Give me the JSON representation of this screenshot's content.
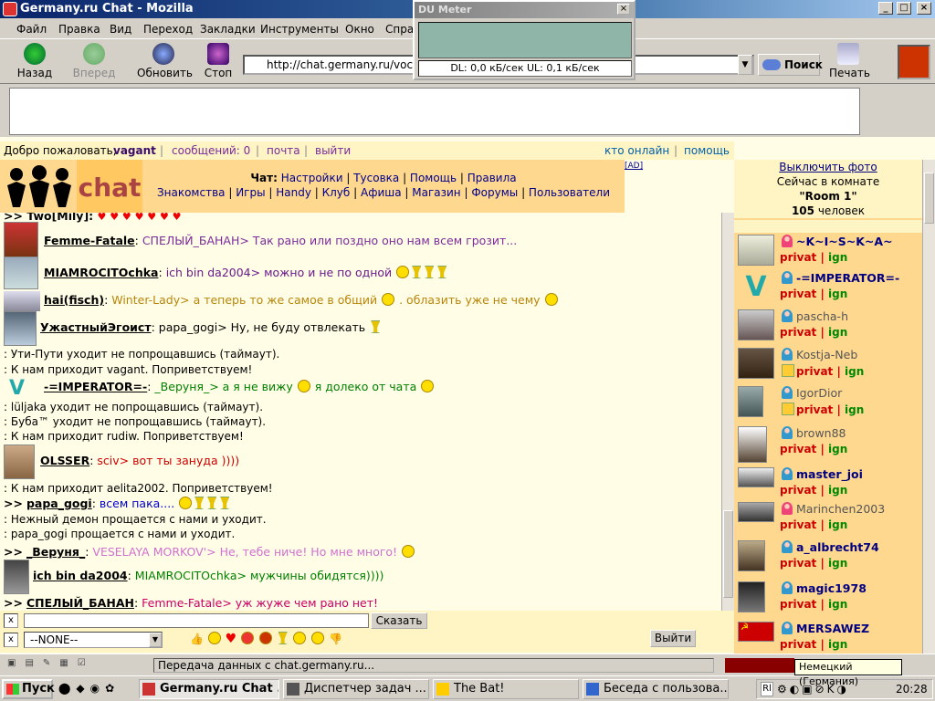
{
  "window": {
    "title": "Germany.ru Chat - Mozilla"
  },
  "menu": [
    "Файл",
    "Правка",
    "Вид",
    "Переход",
    "Закладки",
    "Инструменты",
    "Окно",
    "Справка"
  ],
  "nav": {
    "back": "Назад",
    "forward": "Вперед",
    "reload": "Обновить",
    "stop": "Стоп",
    "search": "Поиск",
    "print": "Печать",
    "url": "http://chat.germany.ru/voc/voc.php"
  },
  "dumeter": {
    "title": "DU Meter",
    "readout": "DL: 0,0 кБ/сек  UL: 0,1 кБ/сек"
  },
  "welcome": {
    "greeting": "Добро пожаловать,",
    "user": "vagant",
    "messages": "сообщений: 0",
    "mail": "почта",
    "logout": "выйти",
    "online": "кто онлайн",
    "help": "помощь",
    "ad": "[AD]"
  },
  "brand": {
    "logo": "chat"
  },
  "chatnav": {
    "lead": "Чат:",
    "row1": [
      "Настройки",
      "Тусовка",
      "Помощь",
      "Правила"
    ],
    "row2": [
      "Знакомства",
      "Игры",
      "Handy",
      "Клуб",
      "Афиша",
      "Магазин",
      "Форумы",
      "Пользователи"
    ]
  },
  "messages": [
    {
      "kind": "partial",
      "text": ">> Two[Mily]:"
    },
    {
      "kind": "msg",
      "nick": "Femme-Fatale",
      "text": "СПЕЛЫЙ_БАНАН> Так рано или поздно оно нам всем грозит...",
      "color": "#7b2c9a"
    },
    {
      "kind": "msg",
      "nick": "MIAMROCITOchka",
      "text": "ich bin da2004> можно и не по одной",
      "color": "#6a1b8a"
    },
    {
      "kind": "msg",
      "nick": "hai(fisch)",
      "text": "Winter-Lady> а теперь то же самое в общий",
      "text2": ". облазить уже не чему",
      "color": "#b8860b"
    },
    {
      "kind": "msg",
      "nick": "УжастныйЭгоист",
      "text": "papa_gogi> Ну, не буду отвлекать",
      "color": "#222222"
    },
    {
      "kind": "sys",
      "text": ": Ути-Пути уходит не попрощавшись (таймаут)."
    },
    {
      "kind": "sys",
      "text": ": К нам приходит vagant. Поприветствуем!"
    },
    {
      "kind": "msg",
      "nick": "-=IMPERATOR=-",
      "text": "_Веруня_> а я не вижу",
      "text2": "я долеко от чата",
      "color": "#008000"
    },
    {
      "kind": "sys",
      "text": ": lüljaka уходит не попрощавшись (таймаут)."
    },
    {
      "kind": "sys",
      "text": ": Буба™ уходит не попрощавшись (таймаут)."
    },
    {
      "kind": "sys",
      "text": ": К нам приходит rudiw. Поприветствуем!"
    },
    {
      "kind": "msg",
      "nick": "OLSSER",
      "text": "sciv> вот ты зануда ))))",
      "color": "#cc0000"
    },
    {
      "kind": "sys",
      "text": ": К нам приходит aelita2002. Поприветствуем!"
    },
    {
      "kind": "msg",
      "nick": "papa_gogi",
      "prefix": ">>",
      "text": "всем пака....",
      "color": "#0000cc"
    },
    {
      "kind": "sys",
      "text": ": Нежный демон прощается с нами и уходит."
    },
    {
      "kind": "sys",
      "text": ": papa_gogi прощается с нами и уходит."
    },
    {
      "kind": "msg",
      "nick": "_Веруня_",
      "prefix": ">>",
      "text": "VESELAYA MORKOV'> Не, тебе ниче! Но мне много!",
      "color": "#d070d0"
    },
    {
      "kind": "msg",
      "nick": "ich bin da2004",
      "text": "MIAMROCITOchka> мужчины обидятся))))",
      "color": "#008000"
    },
    {
      "kind": "msg",
      "nick": "СПЕЛЫЙ_БАНАН",
      "prefix": ">>",
      "text": "Femme-Fatale> уж жуже чем рано нет!",
      "color": "#cc0066"
    }
  ],
  "input": {
    "send": "Сказать",
    "recipient": "--NONE--",
    "exit": "Выйти",
    "clear": "x"
  },
  "sidebar": {
    "photos_off": "Выключить фото",
    "in_room": "Сейчас в комнате",
    "room": "\"Room 1\"",
    "count": "105",
    "count_label": "человек",
    "privat": "privat",
    "ign": "ign",
    "users": [
      "~K~I~S~K~A~",
      "-=IMPERATOR=-",
      "pascha-h",
      "Kostja-Neb",
      "IgorDior",
      "brown88",
      "master_joi",
      "Marinchen2003",
      "a_albrecht74",
      "magic1978",
      "MERSAWEZ"
    ]
  },
  "status": {
    "text": "Передача данных с chat.germany.ru...",
    "tooltip": "Немецкий (Германия)"
  },
  "taskbar": {
    "start": "Пуск",
    "tasks": [
      "Germany.ru Chat ...",
      "Диспетчер задач ...",
      "The Bat!",
      "Беседа с пользова..."
    ],
    "lang": "Rl",
    "clock": "20:28"
  }
}
